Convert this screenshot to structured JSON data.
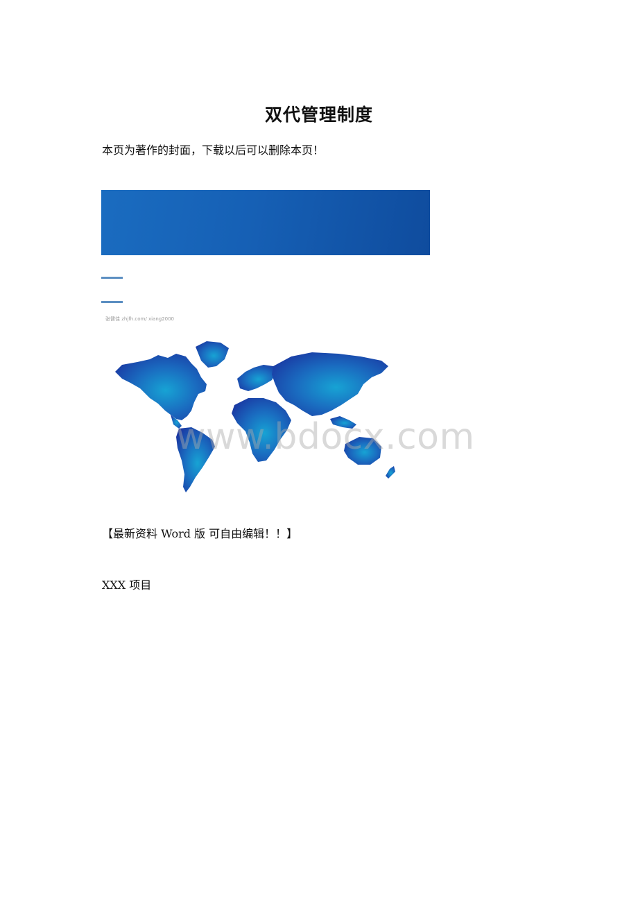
{
  "document": {
    "title": "双代管理制度",
    "cover_notice": "本页为著作的封面，下载以后可以删除本页！",
    "image_caption": "张健佳 zhjfh.com/ xiang2000",
    "watermark": "www.bdocx.com",
    "edit_notice": "【最新资料 Word 版 可自由编辑！！】",
    "project_label": "XXX 项目"
  },
  "colors": {
    "banner_start": "#1a6cc0",
    "banner_end": "#0f4c9e",
    "rule": "#5c8fc2",
    "map_dark": "#1a2a9a",
    "map_light": "#17a3d4"
  },
  "icons": {
    "map": "world-map-image"
  }
}
